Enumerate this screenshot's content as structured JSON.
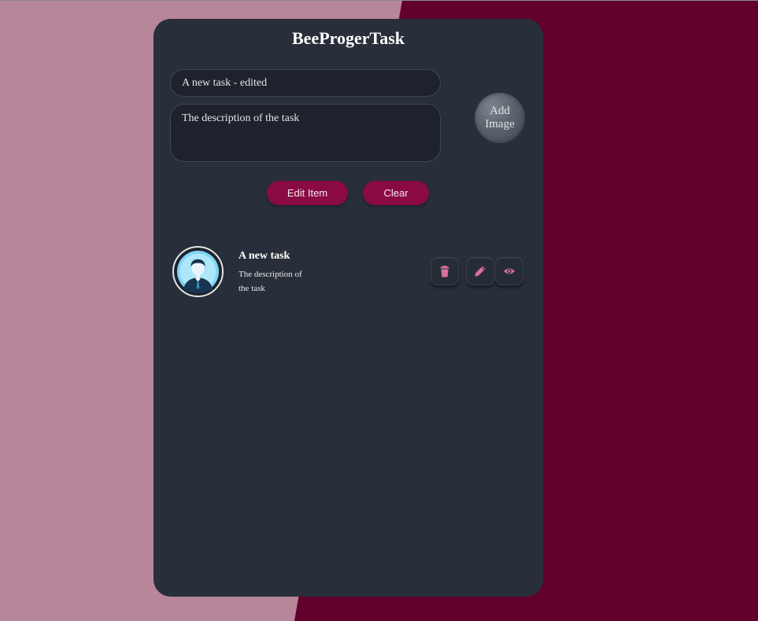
{
  "app": {
    "title": "BeeProgerTask"
  },
  "form": {
    "title_value": "A new task - edited",
    "description_value": "The description of the task",
    "add_image_label": "Add Image"
  },
  "buttons": {
    "edit_label": "Edit Item",
    "clear_label": "Clear"
  },
  "tasks": [
    {
      "title": "A new task",
      "description": "The description of the task",
      "avatar_icon": "user-avatar-icon",
      "action_icons": [
        "trash-icon",
        "pencil-icon",
        "eye-icon"
      ]
    }
  ],
  "colors": {
    "background_left": "#b8869a",
    "background_right": "#62002c",
    "card": "#282f3a",
    "accent_button": "#8a0a44",
    "icon_pink": "#d9709c"
  }
}
